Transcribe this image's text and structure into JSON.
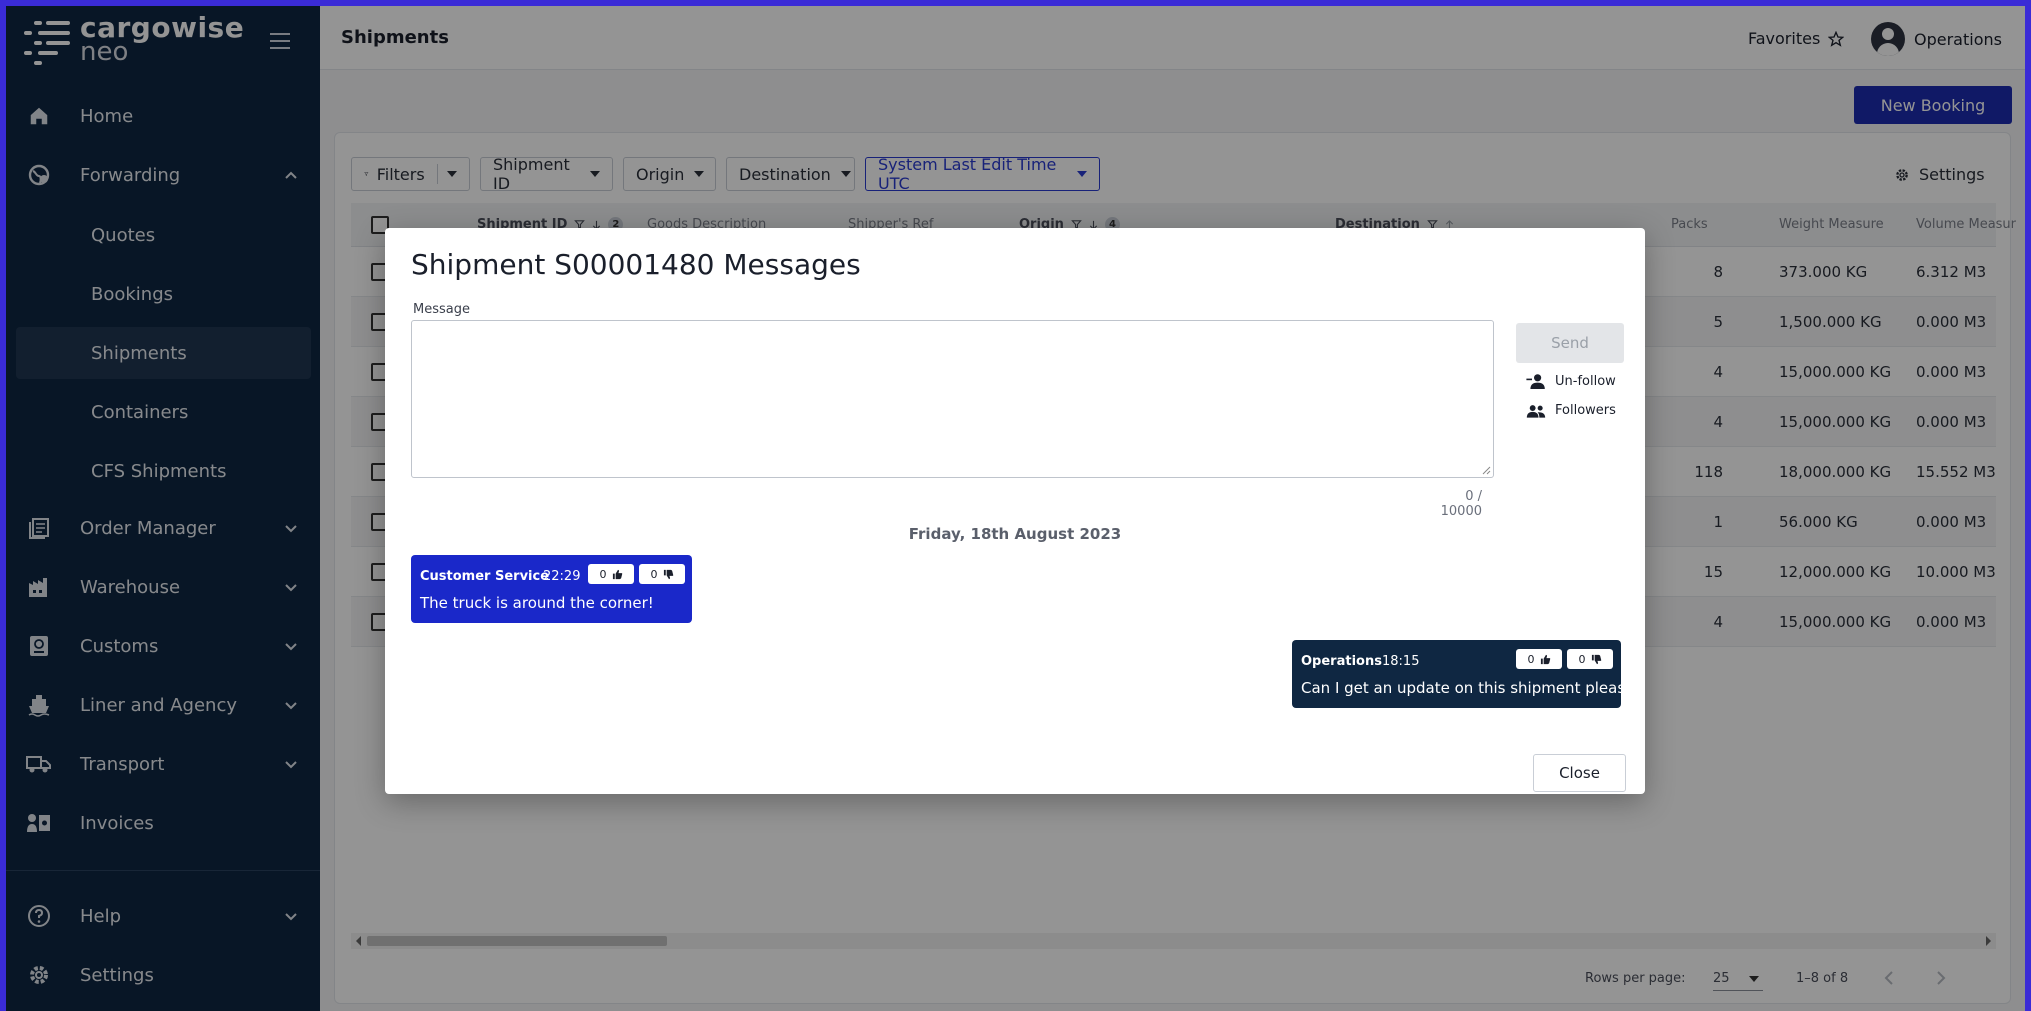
{
  "brand": {
    "line1": "cargowise",
    "line2": "neo"
  },
  "sidebar": {
    "items": [
      {
        "label": "Home",
        "icon": "home-icon"
      },
      {
        "label": "Forwarding",
        "icon": "globe-icon",
        "expanded": true,
        "children": [
          "Quotes",
          "Bookings",
          "Shipments",
          "Containers",
          "CFS Shipments"
        ]
      },
      {
        "label": "Order Manager",
        "icon": "orders-icon"
      },
      {
        "label": "Warehouse",
        "icon": "warehouse-icon"
      },
      {
        "label": "Customs",
        "icon": "passport-icon"
      },
      {
        "label": "Liner and Agency",
        "icon": "ship-icon"
      },
      {
        "label": "Transport",
        "icon": "truck-icon"
      },
      {
        "label": "Invoices",
        "icon": "invoice-icon"
      },
      {
        "label": "Help",
        "icon": "help-icon"
      },
      {
        "label": "Settings",
        "icon": "gear-icon"
      }
    ],
    "active": "Shipments"
  },
  "header": {
    "title": "Shipments",
    "favorites": "Favorites",
    "user": "Operations"
  },
  "toolbar": {
    "new_booking": "New Booking",
    "filters": [
      "Filters",
      "Shipment ID",
      "Origin",
      "Destination",
      "System Last Edit Time UTC"
    ],
    "settings": "Settings"
  },
  "table": {
    "columns": [
      "Shipment ID",
      "Goods Description",
      "Shipper's Ref",
      "Origin",
      "Destination",
      "Packs",
      "Weight Measure",
      "Volume Measur"
    ],
    "sort_counts": {
      "shipment_id": "2",
      "origin": "4"
    },
    "rows": [
      {
        "packs": "8",
        "weight": "373.000 KG",
        "volume": "6.312 M3"
      },
      {
        "packs": "5",
        "weight": "1,500.000 KG",
        "volume": "0.000 M3"
      },
      {
        "packs": "4",
        "weight": "15,000.000 KG",
        "volume": "0.000 M3"
      },
      {
        "packs": "4",
        "weight": "15,000.000 KG",
        "volume": "0.000 M3"
      },
      {
        "packs": "118",
        "weight": "18,000.000 KG",
        "volume": "15.552 M3"
      },
      {
        "packs": "1",
        "weight": "56.000 KG",
        "volume": "0.000 M3"
      },
      {
        "packs": "15",
        "weight": "12,000.000 KG",
        "volume": "10.000 M3"
      },
      {
        "packs": "4",
        "weight": "15,000.000 KG",
        "volume": "0.000 M3"
      }
    ],
    "pager": {
      "rows_per_page_label": "Rows per page:",
      "rows_per_page": "25",
      "range": "1–8 of 8"
    }
  },
  "modal": {
    "title": "Shipment S00001480 Messages",
    "message_label": "Message",
    "message_value": "",
    "counter": "0 / 10000",
    "send": "Send",
    "unfollow": "Un-follow",
    "followers": "Followers",
    "date": "Friday, 18th August 2023",
    "messages": [
      {
        "author": "Customer Service",
        "time": "22:29",
        "likes": "0",
        "dislikes": "0",
        "text": "The truck is around the corner!",
        "color": "#1a28c9"
      },
      {
        "author": "Operations",
        "time": "18:15",
        "likes": "0",
        "dislikes": "0",
        "text": "Can I get an update on this shipment please?",
        "color": "#0f2742"
      }
    ],
    "close": "Close"
  },
  "colors": {
    "sidebar": "#0f2742",
    "accent": "#1c2bb0",
    "frame": "#3a2bd6"
  }
}
